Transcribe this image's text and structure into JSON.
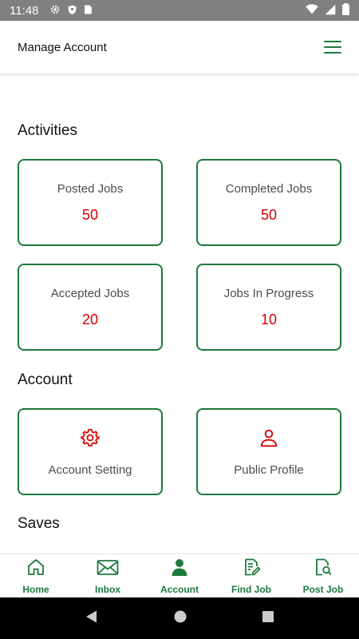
{
  "status_bar": {
    "time": "11:48",
    "icons": [
      "gear-icon",
      "shield-icon",
      "sim-card-icon",
      "wifi-icon",
      "signal-icon",
      "battery-icon"
    ]
  },
  "header": {
    "title": "Manage Account",
    "menu_icon": "hamburger-menu-icon"
  },
  "activities": {
    "title": "Activities",
    "cards": [
      {
        "label": "Posted Jobs",
        "value": "50"
      },
      {
        "label": "Completed Jobs",
        "value": "50"
      },
      {
        "label": "Accepted Jobs",
        "value": "20"
      },
      {
        "label": "Jobs In Progress",
        "value": "10"
      }
    ]
  },
  "account": {
    "title": "Account",
    "cards": [
      {
        "label": "Account Setting",
        "icon": "gear-icon"
      },
      {
        "label": "Public Profile",
        "icon": "person-icon"
      }
    ]
  },
  "saves": {
    "title": "Saves"
  },
  "bottom_nav": [
    {
      "label": "Home",
      "icon": "home-icon"
    },
    {
      "label": "Inbox",
      "icon": "mail-icon"
    },
    {
      "label": "Account",
      "icon": "person-icon",
      "active": true
    },
    {
      "label": "Find Job",
      "icon": "document-edit-icon"
    },
    {
      "label": "Post Job",
      "icon": "document-search-icon"
    }
  ],
  "colors": {
    "primary_green": "#1c7a3c",
    "value_red": "#d50000",
    "status_bar": "#808080"
  }
}
